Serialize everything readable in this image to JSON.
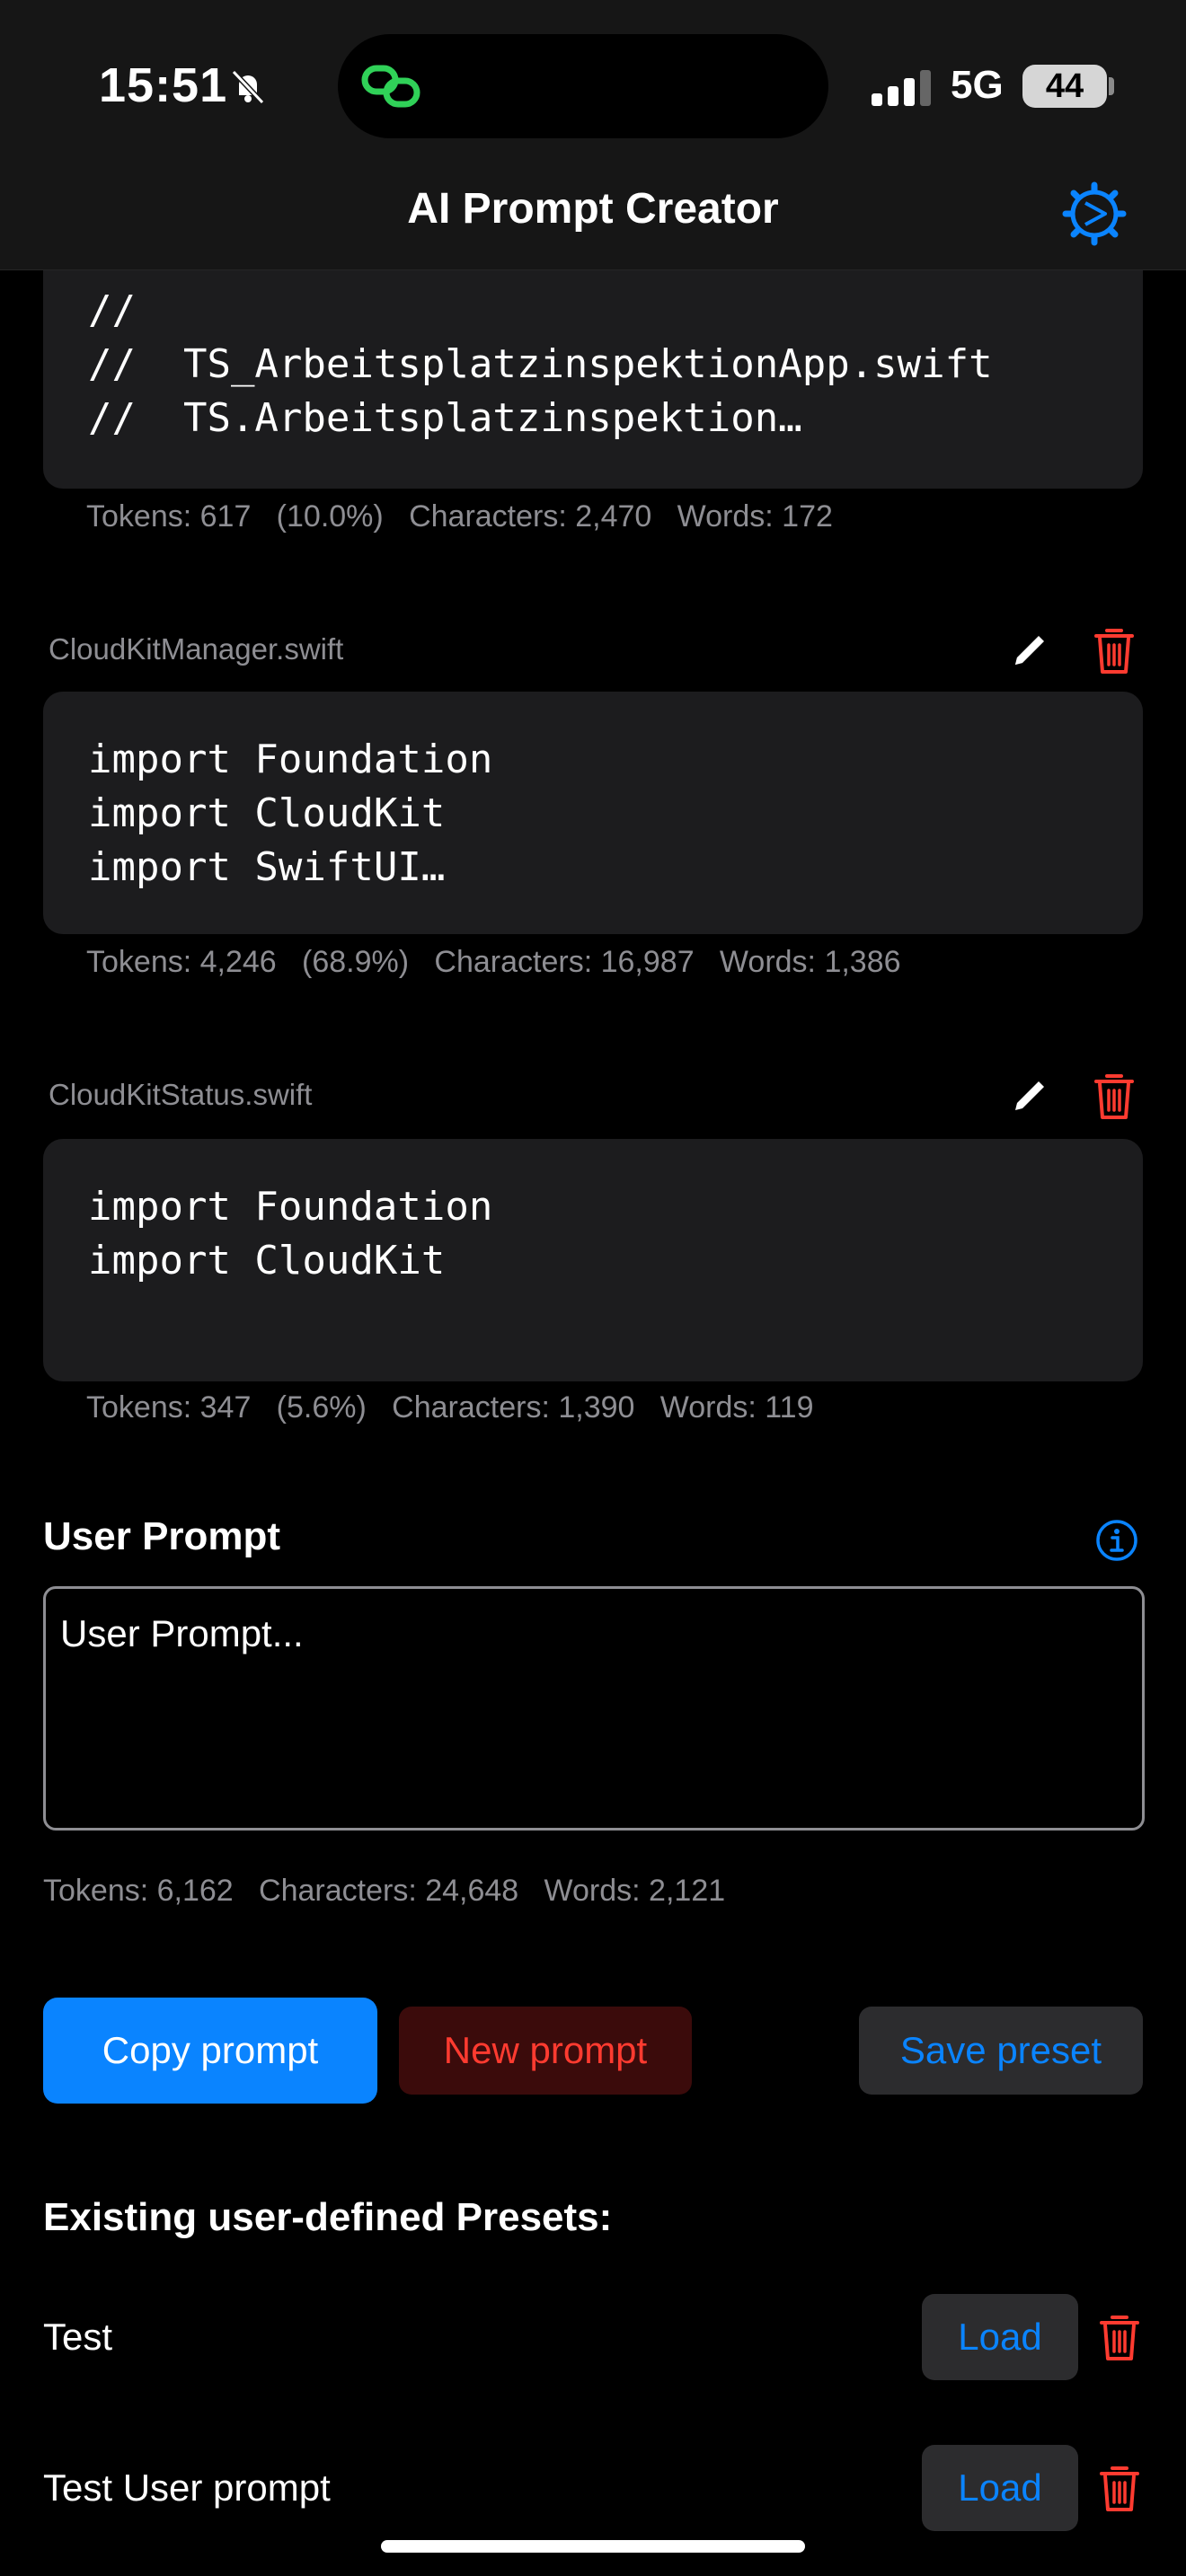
{
  "status_bar": {
    "time": "15:51",
    "network": "5G",
    "battery": "44"
  },
  "nav": {
    "title": "AI Prompt Creator",
    "settings_icon": "gear-icon"
  },
  "files": [
    {
      "name": "",
      "code": "//\n//  TS_ArbeitsplatzinspektionApp.swift\n//  TS.Arbeitsplatzinspektion…",
      "stats": "Tokens: 617   (10.0%)   Characters: 2,470   Words: 172"
    },
    {
      "name": "CloudKitManager.swift",
      "code": "import Foundation\nimport CloudKit\nimport SwiftUI…",
      "stats": "Tokens: 4,246   (68.9%)   Characters: 16,987   Words: 1,386"
    },
    {
      "name": "CloudKitStatus.swift",
      "code": "import Foundation\nimport CloudKit",
      "stats": "Tokens: 347   (5.6%)   Characters: 1,390   Words: 119"
    }
  ],
  "user_prompt": {
    "title": "User Prompt",
    "placeholder": "User Prompt...",
    "stats": "Tokens: 6,162   Characters: 24,648   Words: 2,121"
  },
  "actions": {
    "copy": "Copy prompt",
    "new": "New prompt",
    "save": "Save preset"
  },
  "presets": {
    "title": "Existing user-defined Presets:",
    "items": [
      {
        "name": "Test",
        "load": "Load"
      },
      {
        "name": "Test User prompt",
        "load": "Load"
      }
    ]
  },
  "colors": {
    "accent": "#0a84ff",
    "destructive": "#ff3b30",
    "card": "#1c1c1e",
    "secondary_text": "#8e8e93"
  }
}
